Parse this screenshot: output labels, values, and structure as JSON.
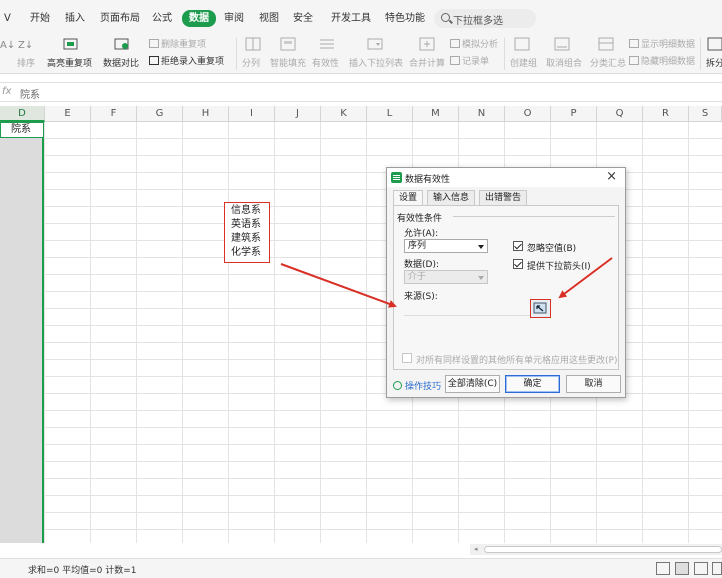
{
  "menu": {
    "items": [
      "开始",
      "插入",
      "页面布局",
      "公式",
      "数据",
      "审阅",
      "视图",
      "安全",
      "开发工具",
      "特色功能"
    ],
    "active": "数据",
    "search_placeholder": "下拉框多选"
  },
  "ribbon": {
    "sort_label": "排序",
    "highlight_dup_label": "高亮重复项",
    "data_compare_label": "数据对比",
    "delete_dup_label": "删除重复项",
    "reject_dup_label": "拒绝录入重复项",
    "split_label": "分列",
    "smart_fill_label": "智能填充",
    "validity_label": "有效性",
    "insert_dropdown_label": "插入下拉列表",
    "merge_calc_label": "合并计算",
    "simulate_label": "模拟分析",
    "record_label": "记录单",
    "create_group_label": "创建组",
    "ungroup_label": "取消组合",
    "subtotal_label": "分类汇总",
    "show_detail_label": "显示明细数据",
    "hide_detail_label": "隐藏明细数据",
    "split_table_label": "拆分"
  },
  "formula_bar": {
    "fx": "fx",
    "content": "院系"
  },
  "grid": {
    "columns": [
      "D",
      "E",
      "F",
      "G",
      "H",
      "I",
      "J",
      "K",
      "L",
      "M",
      "N",
      "O",
      "P",
      "Q",
      "R",
      "S"
    ],
    "selected_column": "D",
    "cell_d1": "院系",
    "list_values": [
      "信息系",
      "英语系",
      "建筑系",
      "化学系"
    ]
  },
  "dialog": {
    "title": "数据有效性",
    "close": "×",
    "tabs": [
      "设置",
      "输入信息",
      "出错警告"
    ],
    "active_tab": "设置",
    "section_title": "有效性条件",
    "allow_label": "允许(A):",
    "allow_value": "序列",
    "data_label": "数据(D):",
    "data_value": "介于",
    "ignore_blank_label": "忽略空值(B)",
    "ignore_blank_checked": true,
    "dropdown_arrow_label": "提供下拉箭头(I)",
    "dropdown_arrow_checked": true,
    "source_label": "来源(S):",
    "source_value": "",
    "apply_all_label": "对所有同样设置的其他所有单元格应用这些更改(P)",
    "apply_all_checked": false,
    "tips_label": "操作技巧",
    "clear_all_label": "全部清除(C)",
    "ok_label": "确定",
    "cancel_label": "取消"
  },
  "status_bar": {
    "text": "求和=0  平均值=0  计数=1"
  },
  "colors": {
    "accent": "#1e9c4e",
    "highlight_red": "#d93025",
    "link_blue": "#2b6ccf"
  }
}
